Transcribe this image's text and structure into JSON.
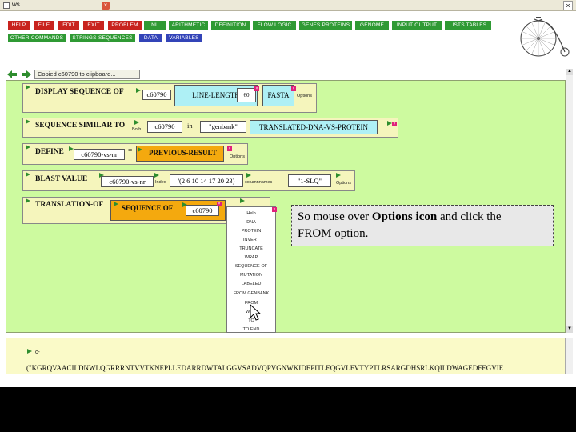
{
  "window": {
    "tab_title": "ws",
    "tab_close": "×",
    "close": "×"
  },
  "menu": {
    "row1": [
      "HELP",
      "FILE",
      "EDIT",
      "EXIT",
      "PROBLEM",
      "NL",
      "ARITHMETIC",
      "DEFINITION",
      "FLOW LOGIC",
      "GENES PROTEINS",
      "GENOME",
      "INPUT OUTPUT",
      "LISTS TABLES"
    ],
    "row2": [
      "OTHER-COMMANDS",
      "STRINGS-SEQUENCES",
      "DATA",
      "VARIABLES"
    ]
  },
  "status": "Copied c60790 to clipboard...",
  "workspace": {
    "row1": {
      "keyword": "DISPLAY SEQUENCE OF",
      "arg": "c60790",
      "mode": "LINE-LENGTH",
      "fmt": "FASTA",
      "options": "Options"
    },
    "row2": {
      "keyword": "SEQUENCE SIMILAR TO",
      "arg": "c60790",
      "in": "in",
      "db": "\"genbank\"",
      "mode": "TRANSLATED-DNA-VS-PROTEIN",
      "both": "Both"
    },
    "row3": {
      "keyword": "DEFINE",
      "arg": "c60790-vs-nr",
      "eq": "=",
      "value": "PREVIOUS-RESULT",
      "options": "Options"
    },
    "row4": {
      "keyword": "BLAST VALUE",
      "arg": "c60790-vs-nr",
      "index": "'(2 6 10 14 17 20 23)",
      "fmt": "\"1-SLQ\"",
      "index_label": "Index",
      "cols_label": "columnnames",
      "options": "Options"
    },
    "row5": {
      "keyword": "TRANSLATION-OF",
      "sub": "SEQUENCE OF",
      "arg": "c60790"
    }
  },
  "popup": {
    "items": [
      "Help",
      "DNA",
      "PROTEIN",
      "INVERT",
      "TRUNCATE",
      "WRAP",
      "SEQUENCE-OF",
      "MUTATION",
      "LABELED",
      "FROM GENBANK",
      "FROM",
      "WITH",
      "TO",
      "TO END"
    ]
  },
  "tooltip": {
    "line1_pre": "So mouse over ",
    "line1_bold": "Options icon",
    "line1_post": " and click the",
    "line2": "FROM option."
  },
  "output": {
    "label": "c-",
    "sequence": "(\"KGRQVAACILDNWLQGRRRNTVVTKNEPLLEDARRDWTALGGVSADVQPVGNWKIDEPITLEQGVLFVTYPTLRSARGDHSRLKQILDWAGEDFEGVIE"
  },
  "colors": {
    "workspace_bg": "#cdfa9f",
    "row_bg": "#f5f5bc",
    "cyan": "#aef0f5",
    "orange": "#f4a90e",
    "menu_red": "#c8231e",
    "menu_green": "#2f9a34",
    "menu_blue": "#3344b8"
  }
}
